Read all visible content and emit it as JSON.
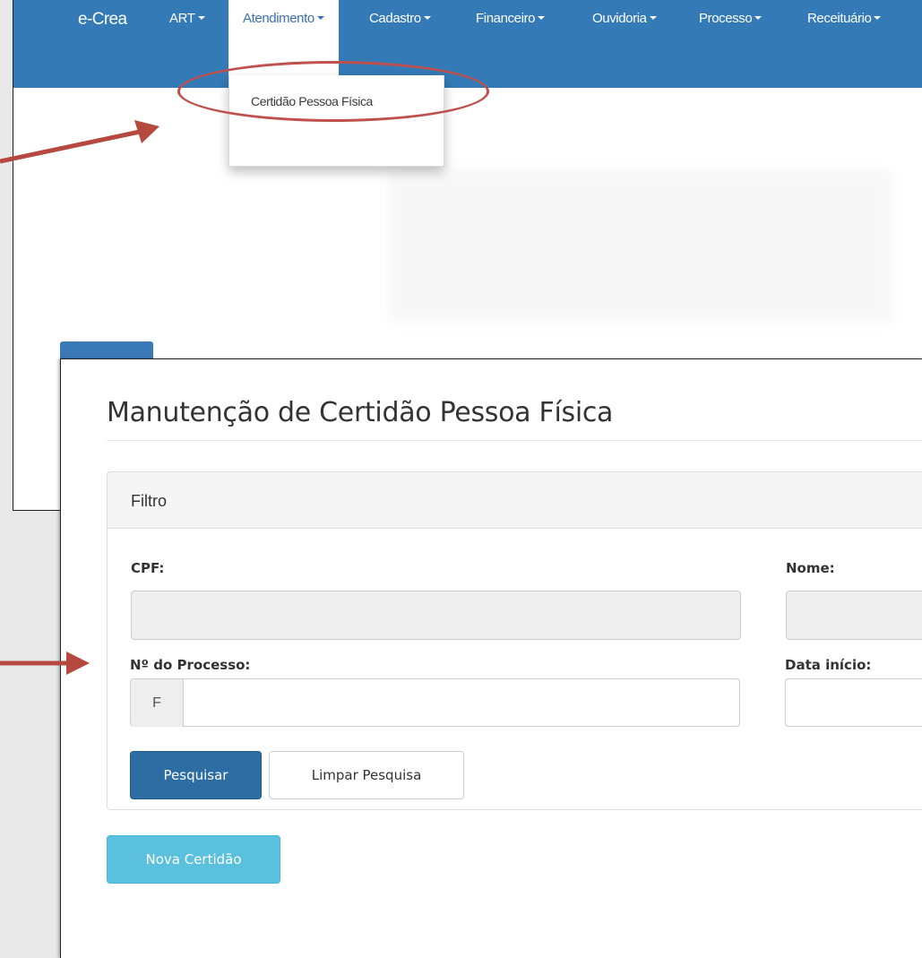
{
  "navbar": {
    "brand": "e-Crea",
    "menus": [
      {
        "label": "ART"
      },
      {
        "label": "Atendimento"
      },
      {
        "label": "Cadastro"
      },
      {
        "label": "Financeiro"
      },
      {
        "label": "Ouvidoria"
      },
      {
        "label": "Processo"
      },
      {
        "label": "Receituário"
      }
    ],
    "active_menu": "Atendimento",
    "dropdown": {
      "item_label": "Certidão Pessoa Física"
    }
  },
  "page": {
    "title": "Manutenção de Certidão Pessoa Física",
    "filter_panel": {
      "heading": "Filtro",
      "cpf_label": "CPF:",
      "cpf_value": "",
      "nome_label": "Nome:",
      "nome_value": "",
      "processo_label": "Nº do Processo:",
      "processo_prefix": "F",
      "processo_value": "",
      "data_inicio_label": "Data início:",
      "data_inicio_value": "",
      "search_button": "Pesquisar",
      "clear_button": "Limpar Pesquisa"
    },
    "new_button": "Nova Certidão"
  },
  "annotation_colors": {
    "arrow": "#b5493f",
    "highlight": "#c0504d"
  }
}
